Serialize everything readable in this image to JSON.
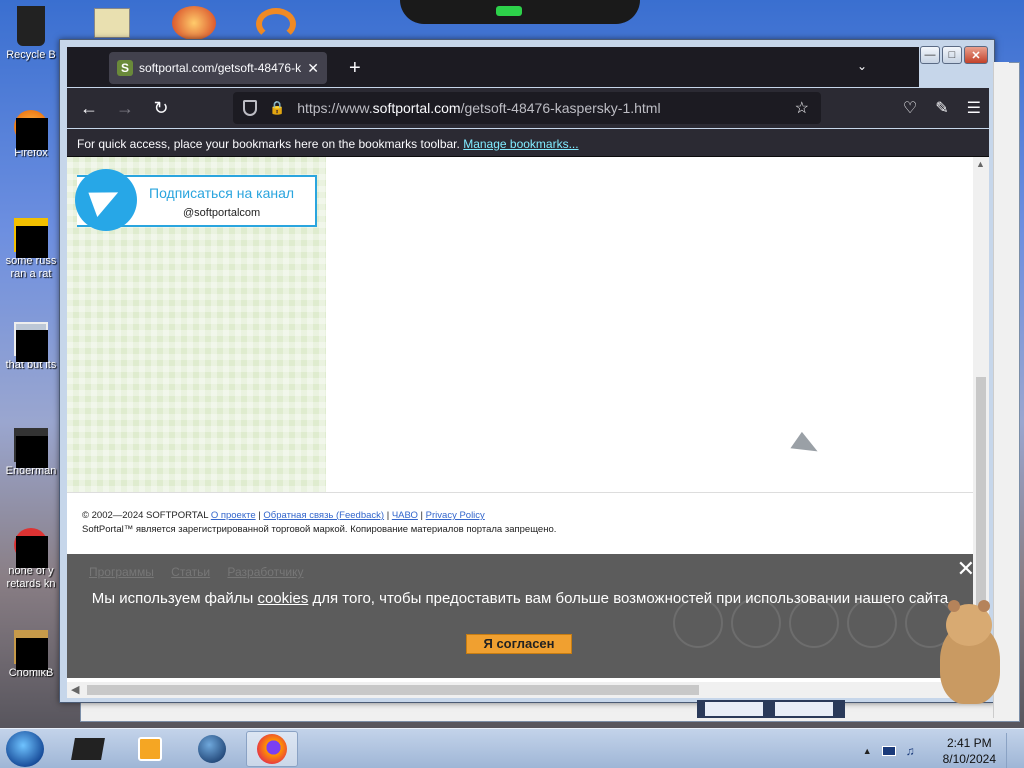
{
  "desktop": {
    "icons": [
      {
        "label": "Recycle B",
        "icon": "recycle-bin-icon"
      },
      {
        "label": "Firefox",
        "icon": "firefox-icon"
      },
      {
        "label": "some russ",
        "label2": "ran a rat",
        "icon": "file-icon"
      },
      {
        "label": "that but its",
        "icon": "folder-icon"
      },
      {
        "label": "Enderman",
        "icon": "file-icon"
      },
      {
        "label": "none of y",
        "label2": "retards kn",
        "icon": "file-icon"
      },
      {
        "label": "ChomikB",
        "icon": "hamster-icon"
      }
    ]
  },
  "browser": {
    "tab_title": "softportal.com/getsoft-48476-k",
    "tab_favicon": "S",
    "url_prefix": "https://www.",
    "url_host": "softportal.com",
    "url_path": "/getsoft-48476-kaspersky-1.html",
    "bookmarks_bar_text": "For quick access, place your bookmarks here on the bookmarks toolbar.",
    "bookmarks_bar_link": "Manage bookmarks..."
  },
  "page": {
    "telegram_line1": "Подписаться на канал",
    "telegram_line2": "@softportalcom",
    "footer": {
      "copyright": "© 2002—2024 SOFTPORTAL",
      "links": [
        "О проекте",
        "Обратная связь (Feedback)",
        "ЧАВО",
        "Privacy Policy"
      ],
      "trademark": "SoftPortal™ является зарегистрированной торговой маркой. Копирование материалов портала запрещено."
    },
    "cookie_banner": {
      "nav_links": [
        "Программы",
        "Статьи",
        "Разработчику"
      ],
      "message_before": "Мы используем файлы ",
      "message_link": "cookies",
      "message_after": " для того, чтобы предоставить вам больше возможностей при использовании нашего сайта",
      "agree_button": "Я согласен"
    }
  },
  "taskbar": {
    "time": "2:41 PM",
    "date": "8/10/2024"
  },
  "colors": {
    "firefox_dark": "#2b2a33",
    "telegram_blue": "#27a7e7",
    "agree_orange": "#f0a030"
  }
}
